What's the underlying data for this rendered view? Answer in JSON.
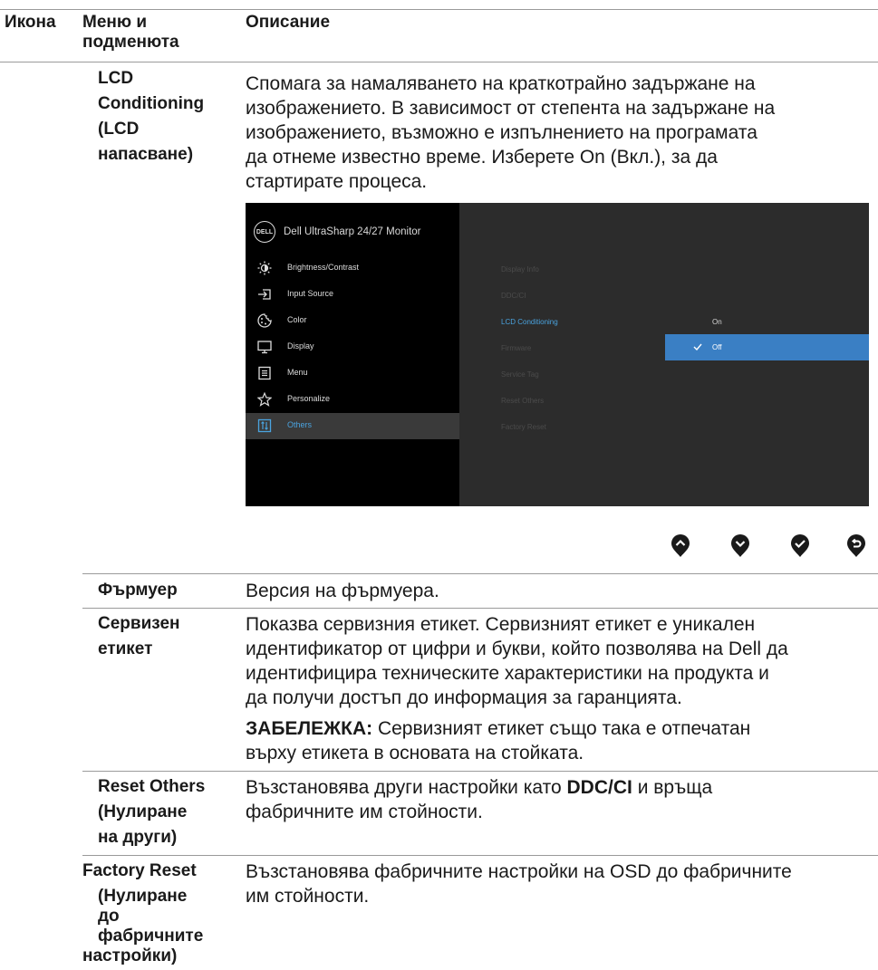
{
  "header": {
    "col_icon": "Икона",
    "col_menu_line1": "Меню и",
    "col_menu_line2": "подменюта",
    "col_desc": "Описание"
  },
  "rows": {
    "lcd": {
      "label": [
        "LCD",
        "Conditioning",
        "(LCD",
        "напасване)"
      ],
      "desc": [
        "Спомага за намаляването на краткотрайно задържане на",
        "изображението. В зависимост от степента на задържане на",
        "изображението, възможно е изпълнението на програмата",
        "да отнеме известно време. Изберете On (Вкл.), за да",
        "стартирате процеса."
      ]
    },
    "firmware": {
      "label": "Фърмуер",
      "desc": "Версия на фърмуера."
    },
    "service_tag": {
      "label": [
        "Сервизен",
        "етикет"
      ],
      "desc": [
        "Показва сервизния етикет. Сервизният етикет е уникален",
        "идентификатор от цифри и букви, който позволява на Dell да",
        "идентифицира техническите характеристики на продукта и",
        "да получи достъп до информация за гаранцията."
      ],
      "note_bold": "ЗАБЕЛЕЖКА:",
      "note_rest": " Сервизният етикет също така е отпечатан",
      "note_line2": "върху етикета в основата на стойката."
    },
    "reset_others": {
      "label": [
        "Reset Others",
        "(Нулиране",
        "на други)"
      ],
      "desc_a": "Възстановява други настройки като ",
      "desc_bold": "DDC/CI",
      "desc_b": " и връща",
      "desc_line2": "фабричните им стойности."
    },
    "factory_reset": {
      "label": [
        "Factory Reset",
        "(Нулиране",
        "до",
        "фабричните",
        "настройки)"
      ],
      "desc": [
        "Възстановява фабричните настройки на OSD до фабричните",
        "им стойности."
      ]
    }
  },
  "osd": {
    "logo": "DELL",
    "title": "Dell UltraSharp 24/27 Monitor",
    "menu": [
      {
        "label": "Brightness/Contrast",
        "icon": "brightness-icon"
      },
      {
        "label": "Input Source",
        "icon": "input-source-icon"
      },
      {
        "label": "Color",
        "icon": "color-icon"
      },
      {
        "label": "Display",
        "icon": "display-icon"
      },
      {
        "label": "Menu",
        "icon": "menu-icon"
      },
      {
        "label": "Personalize",
        "icon": "star-icon"
      },
      {
        "label": "Others",
        "icon": "others-icon",
        "selected": true
      }
    ],
    "submenu": [
      "Display Info",
      "DDC/CI",
      "LCD Conditioning",
      "Firmware",
      "Service Tag",
      "Reset Others",
      "Factory Reset"
    ],
    "submenu_active": "LCD Conditioning",
    "options": {
      "on": "On",
      "off": "Off",
      "selected": "Off"
    },
    "accent": "#3a7fc4"
  },
  "nav_buttons": [
    "up-icon",
    "down-icon",
    "check-icon",
    "back-icon"
  ]
}
